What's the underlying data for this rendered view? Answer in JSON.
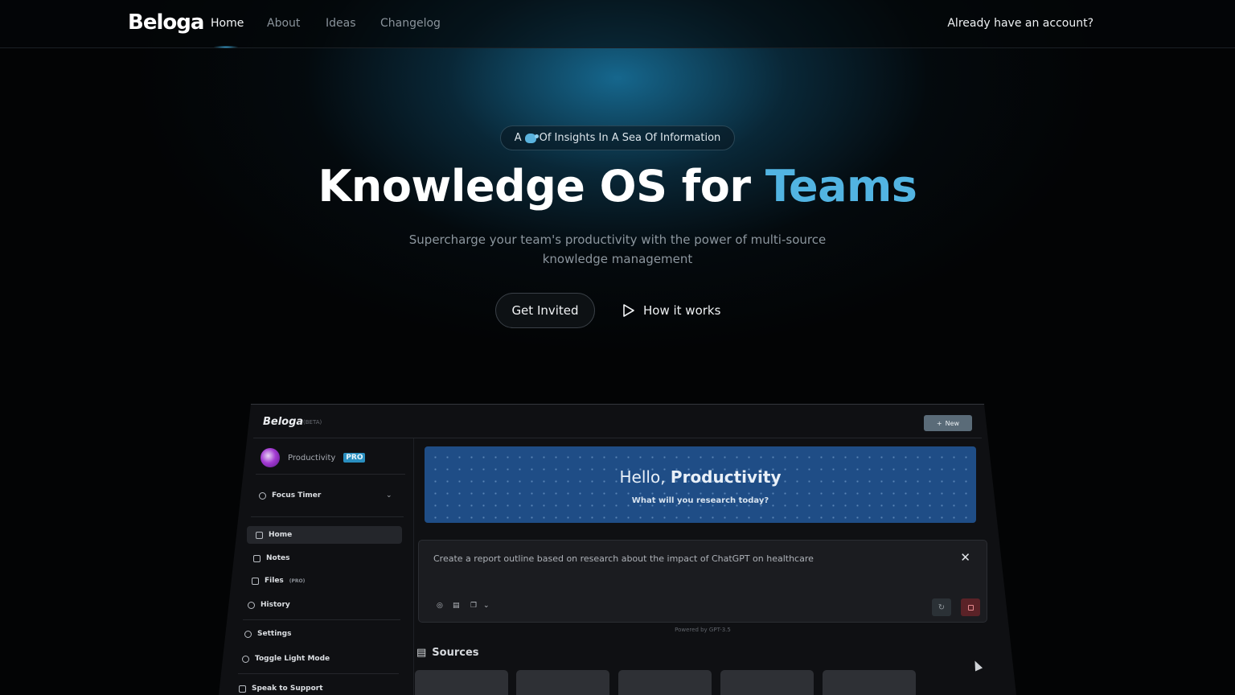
{
  "nav": {
    "logo": "Beloga",
    "links": [
      "Home",
      "About",
      "Ideas",
      "Changelog"
    ],
    "account": "Already have an account?"
  },
  "hero": {
    "badge_prefix": "A",
    "badge_text": "Of Insights In A Sea Of Information",
    "headline_main": "Knowledge OS for ",
    "headline_accent": "Teams",
    "subtitle": "Supercharge your team's productivity with the power of multi-source knowledge management",
    "cta_primary": "Get Invited",
    "cta_secondary": "How it works"
  },
  "app": {
    "logo": "Beloga",
    "beta": "(BETA)",
    "new_button": "New",
    "workspace": "Productivity",
    "workspace_badge": "PRO",
    "focus_timer": "Focus Timer",
    "sidebar": {
      "home": "Home",
      "notes": "Notes",
      "files": "Files",
      "files_tag": "(PRO)",
      "history": "History",
      "settings": "Settings",
      "toggle_light": "Toggle Light Mode",
      "support": "Speak to Support"
    },
    "greeting_prefix": "Hello, ",
    "greeting_name": "Productivity",
    "greeting_question": "What will you research today?",
    "prompt_text": "Create a report outline based on research about the impact of ChatGPT on healthcare",
    "powered_by": "Powered by GPT-3.5",
    "sources_label": "Sources"
  },
  "colors": {
    "accent": "#52b4e2",
    "hero_card": "#1f4d86",
    "pro_badge": "#2a8fc0"
  }
}
